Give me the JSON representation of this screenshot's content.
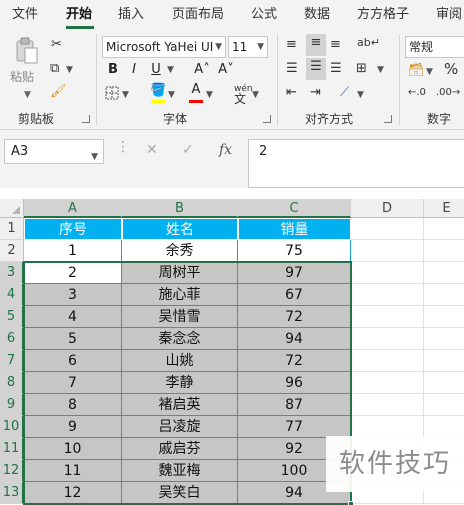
{
  "tabs": [
    "文件",
    "开始",
    "插入",
    "页面布局",
    "公式",
    "数据",
    "方方格子",
    "审阅"
  ],
  "ribbon": {
    "clipboard": {
      "paste_label": "粘贴",
      "group_label": "剪贴板"
    },
    "font": {
      "font_name": "Microsoft YaHei UI",
      "font_size": "11",
      "bold": "B",
      "italic": "I",
      "underline": "U",
      "grow": "A˄",
      "shrink": "A˅",
      "phonetic": "wén",
      "highlight_color": "#ffff00",
      "font_color": "#ff0000",
      "group_label": "字体"
    },
    "alignment": {
      "group_label": "对齐方式"
    },
    "number": {
      "format": "常规",
      "percent": "%",
      "group_label": "数字"
    }
  },
  "formula_bar": {
    "name_box": "A3",
    "value": "2",
    "fx": "fx"
  },
  "columns": [
    "A",
    "B",
    "C",
    "D",
    "E"
  ],
  "rows": [
    "1",
    "2",
    "3",
    "4",
    "5",
    "6",
    "7",
    "8",
    "9",
    "10",
    "11",
    "12",
    "13"
  ],
  "table": {
    "headers": [
      "序号",
      "姓名",
      "销量"
    ],
    "rows": [
      [
        "1",
        "余秀",
        "75"
      ],
      [
        "2",
        "周树平",
        "97"
      ],
      [
        "3",
        "施心菲",
        "67"
      ],
      [
        "4",
        "吴惜雪",
        "72"
      ],
      [
        "5",
        "秦念念",
        "94"
      ],
      [
        "6",
        "山姚",
        "72"
      ],
      [
        "7",
        "李静",
        "96"
      ],
      [
        "8",
        "褚启英",
        "87"
      ],
      [
        "9",
        "吕凌旋",
        "77"
      ],
      [
        "10",
        "戚启芬",
        "92"
      ],
      [
        "11",
        "魏亚梅",
        "100"
      ],
      [
        "12",
        "吴笑白",
        "94"
      ]
    ]
  },
  "colors": {
    "header_fill": "#00b0f0",
    "selection_fill": "#c6c6c6",
    "accent": "#217346"
  },
  "watermark": "软件技巧"
}
